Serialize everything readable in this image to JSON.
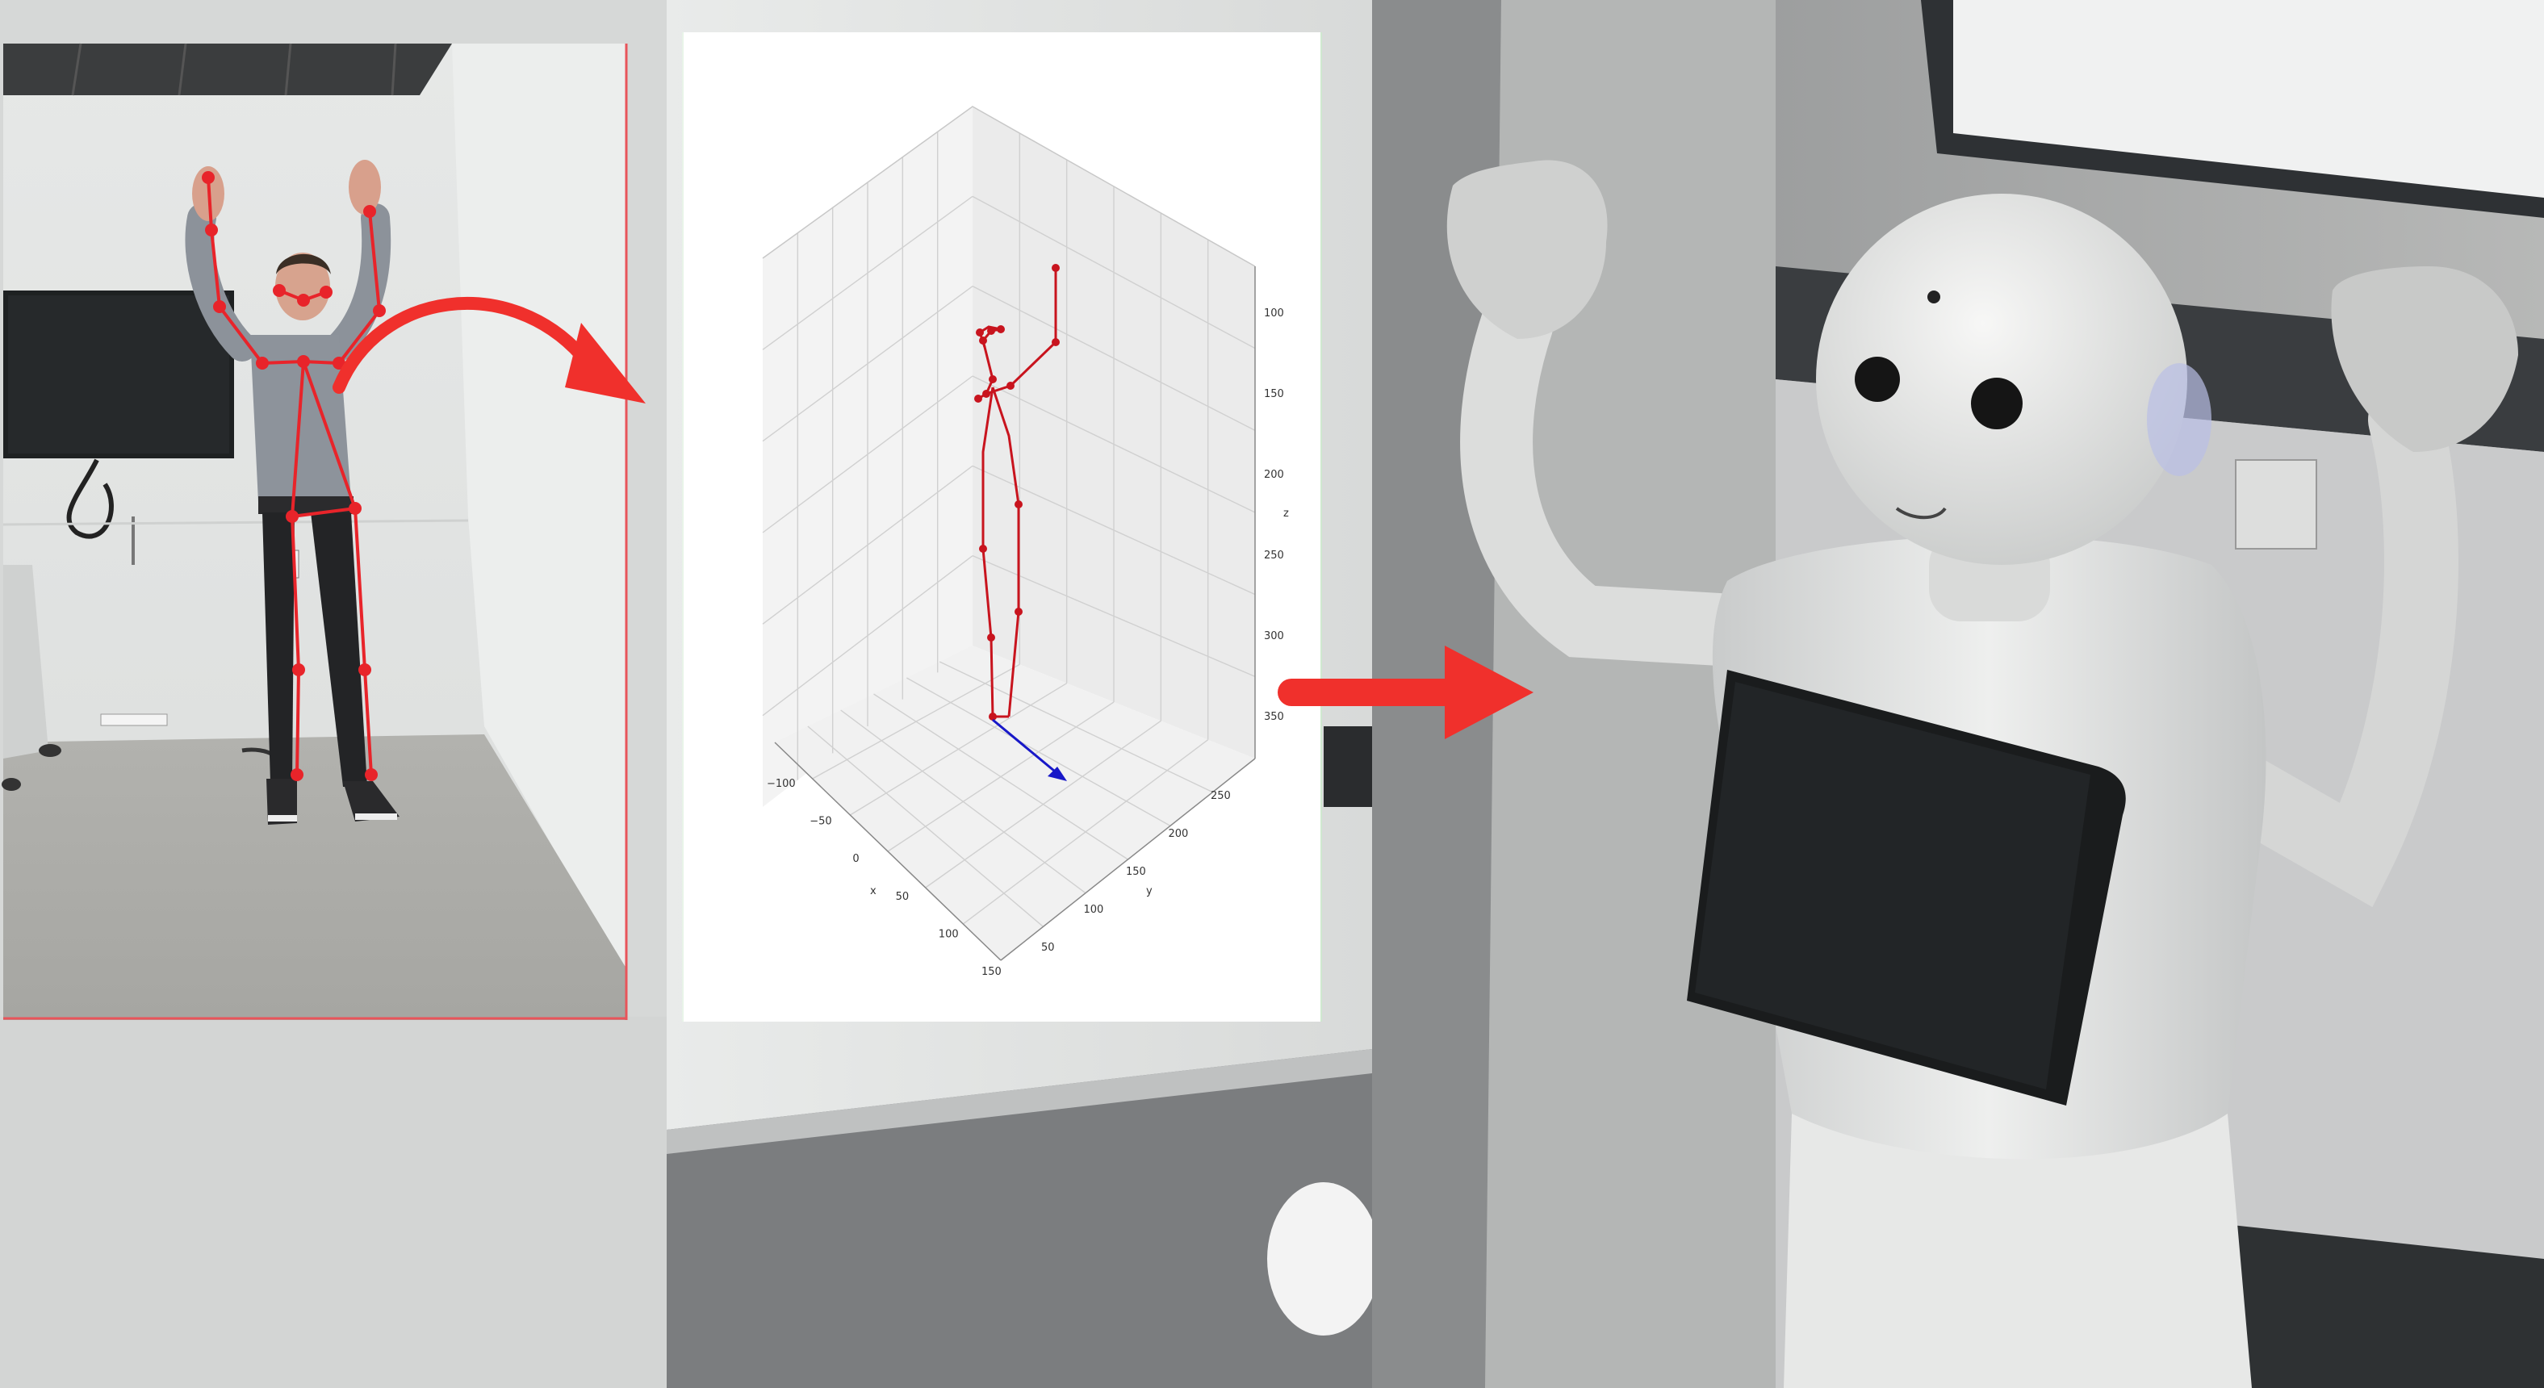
{
  "scene": {
    "panels": [
      "person-camera-photo",
      "3d-pose-plot",
      "pepper-robot-photo"
    ]
  },
  "pose_plot": {
    "axis_labels": {
      "x": "x",
      "y": "y",
      "z": "z"
    },
    "x_ticks": [
      "−100",
      "−50",
      "0",
      "50",
      "100",
      "150"
    ],
    "y_ticks": [
      "50",
      "100",
      "150",
      "200",
      "250"
    ],
    "z_ticks": [
      "100",
      "150",
      "200",
      "250",
      "300",
      "350"
    ],
    "skeleton_color": "#c8141e",
    "direction_color": "#1818c8"
  },
  "arrows": {
    "color": "#f0302c"
  }
}
